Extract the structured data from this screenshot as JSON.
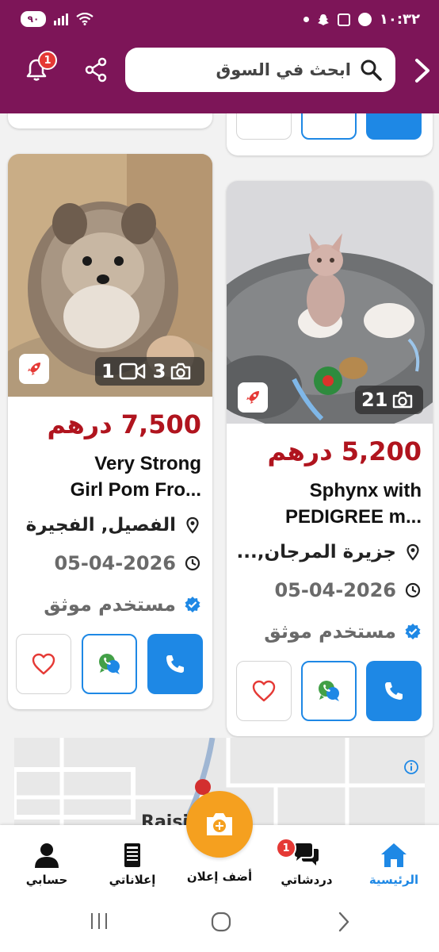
{
  "status_bar": {
    "time": "١٠:٣٢",
    "battery": "٩٠"
  },
  "header": {
    "search_placeholder": "ابحث في السوق",
    "notifications_count": "1",
    "brand_color": "#7d1558"
  },
  "listings": [
    {
      "price": "7,500 درهم",
      "title": "Very Strong Girl Pom Fro...",
      "title_line1": "Very Strong",
      "title_line2": "Girl Pom Fro...",
      "location": "الفصيل, الفجيرة",
      "date": "05-04-2026",
      "verified": "مستخدم موثق",
      "video_count": "1",
      "photo_count": "3",
      "boosted": true
    },
    {
      "price": "5,200 درهم",
      "title": "Sphynx with PEDIGREE m...",
      "title_line1": "Sphynx with",
      "title_line2": "PEDIGREE m...",
      "location": "جزيرة المرجان,...",
      "date": "05-04-2026",
      "verified": "مستخدم موثق",
      "photo_count": "21",
      "boosted": true
    }
  ],
  "ad": {
    "label": "Raisi"
  },
  "bottom_nav": {
    "items": [
      {
        "label": "حسابي",
        "icon": "person-icon"
      },
      {
        "label": "إعلاناتي",
        "icon": "my-ads-icon"
      },
      {
        "label": "أضف إعلان",
        "icon": "camera-add-icon"
      },
      {
        "label": "دردشاتي",
        "icon": "chat-icon",
        "badge": "1"
      },
      {
        "label": "الرئيسية",
        "icon": "home-icon",
        "active": true
      }
    ],
    "active_color": "#1e88e5",
    "fab_color": "#f5a01f"
  },
  "colors": {
    "price": "#b0141e",
    "accent_blue": "#1e88e5",
    "badge_red": "#e53935"
  }
}
